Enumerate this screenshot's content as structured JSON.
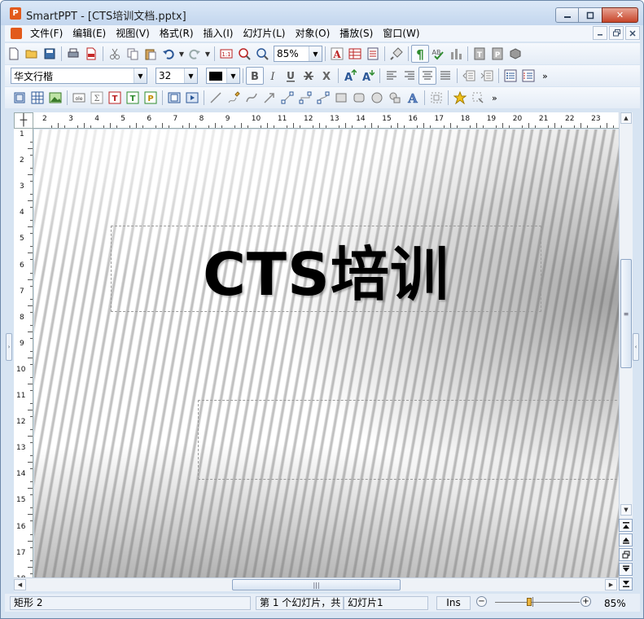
{
  "window": {
    "title": "SmartPPT - [CTS培训文档.pptx]",
    "app_icon": "P",
    "minimize_icon": "minimize-icon",
    "maximize_icon": "maximize-icon",
    "close_label": "✕"
  },
  "menu": {
    "items": [
      "文件(F)",
      "编辑(E)",
      "视图(V)",
      "格式(R)",
      "插入(I)",
      "幻灯片(L)",
      "对象(O)",
      "播放(S)",
      "窗口(W)"
    ]
  },
  "toolbar": {
    "zoom_value": "85%",
    "font_name": "华文行楷",
    "font_size": "32",
    "more": "»"
  },
  "ruler": {
    "top_numbers": [
      "2",
      "3",
      "4",
      "5",
      "6",
      "7",
      "8",
      "9",
      "10",
      "11",
      "12",
      "13",
      "14",
      "15",
      "16",
      "17",
      "18",
      "19",
      "20",
      "21",
      "22",
      "23"
    ],
    "left_numbers": [
      "1",
      "2",
      "3",
      "4",
      "5",
      "6",
      "7",
      "8",
      "9",
      "10",
      "11",
      "12",
      "13",
      "14",
      "15",
      "16",
      "17",
      "18"
    ]
  },
  "slide": {
    "title": "CTS培训",
    "subtitle": ""
  },
  "statusbar": {
    "selection": "矩形 2",
    "slide_position": "第 1 个幻灯片，共",
    "slide_name": "幻灯片1",
    "insert_mode": "Ins",
    "zoom_percent": "85%",
    "zoom_minus": "−",
    "zoom_plus": "+"
  },
  "colors": {
    "accent": "#e25a1c",
    "chrome": "#d7e4f2",
    "font_color": "#000000"
  }
}
